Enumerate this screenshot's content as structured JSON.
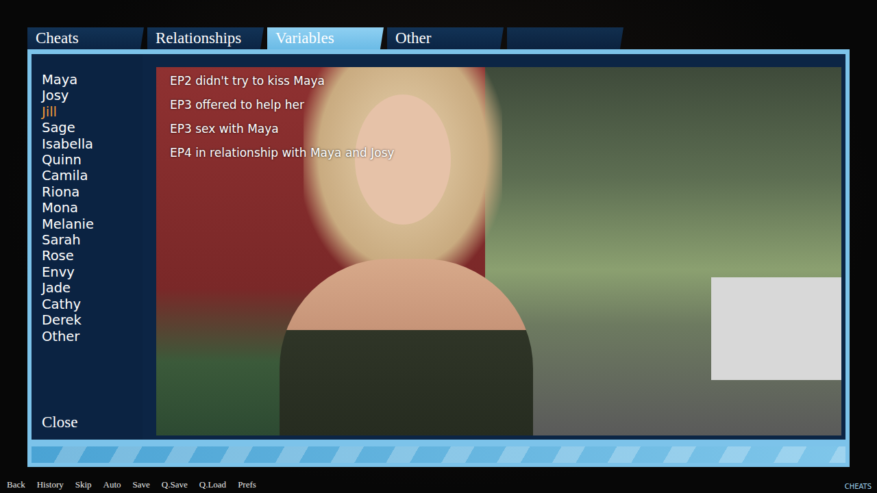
{
  "tabs": [
    {
      "label": "Cheats",
      "selected": false
    },
    {
      "label": "Relationships",
      "selected": false
    },
    {
      "label": "Variables",
      "selected": true
    },
    {
      "label": "Other",
      "selected": false
    }
  ],
  "characters": [
    {
      "name": "Maya",
      "selected": false
    },
    {
      "name": "Josy",
      "selected": false
    },
    {
      "name": "Jill",
      "selected": true
    },
    {
      "name": "Sage",
      "selected": false
    },
    {
      "name": "Isabella",
      "selected": false
    },
    {
      "name": "Quinn",
      "selected": false
    },
    {
      "name": "Camila",
      "selected": false
    },
    {
      "name": "Riona",
      "selected": false
    },
    {
      "name": "Mona",
      "selected": false
    },
    {
      "name": "Melanie",
      "selected": false
    },
    {
      "name": "Sarah",
      "selected": false
    },
    {
      "name": "Rose",
      "selected": false
    },
    {
      "name": "Envy",
      "selected": false
    },
    {
      "name": "Jade",
      "selected": false
    },
    {
      "name": "Cathy",
      "selected": false
    },
    {
      "name": "Derek",
      "selected": false
    },
    {
      "name": "Other",
      "selected": false
    }
  ],
  "close_button": "Close",
  "variables": [
    "EP2 didn't try to kiss Maya",
    "EP3 offered to help her",
    "EP3 sex with Maya",
    "EP4 in relationship with Maya and Josy"
  ],
  "quick_menu": [
    "Back",
    "History",
    "Skip",
    "Auto",
    "Save",
    "Q.Save",
    "Q.Load",
    "Prefs"
  ],
  "corner_label": "CHEATS"
}
